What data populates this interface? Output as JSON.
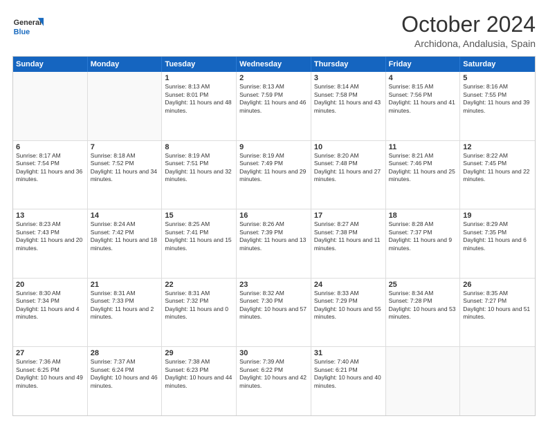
{
  "header": {
    "logo_general": "General",
    "logo_blue": "Blue",
    "month": "October 2024",
    "location": "Archidona, Andalusia, Spain"
  },
  "weekdays": [
    "Sunday",
    "Monday",
    "Tuesday",
    "Wednesday",
    "Thursday",
    "Friday",
    "Saturday"
  ],
  "rows": [
    [
      {
        "day": "",
        "text": ""
      },
      {
        "day": "",
        "text": ""
      },
      {
        "day": "1",
        "text": "Sunrise: 8:13 AM\nSunset: 8:01 PM\nDaylight: 11 hours and 48 minutes."
      },
      {
        "day": "2",
        "text": "Sunrise: 8:13 AM\nSunset: 7:59 PM\nDaylight: 11 hours and 46 minutes."
      },
      {
        "day": "3",
        "text": "Sunrise: 8:14 AM\nSunset: 7:58 PM\nDaylight: 11 hours and 43 minutes."
      },
      {
        "day": "4",
        "text": "Sunrise: 8:15 AM\nSunset: 7:56 PM\nDaylight: 11 hours and 41 minutes."
      },
      {
        "day": "5",
        "text": "Sunrise: 8:16 AM\nSunset: 7:55 PM\nDaylight: 11 hours and 39 minutes."
      }
    ],
    [
      {
        "day": "6",
        "text": "Sunrise: 8:17 AM\nSunset: 7:54 PM\nDaylight: 11 hours and 36 minutes."
      },
      {
        "day": "7",
        "text": "Sunrise: 8:18 AM\nSunset: 7:52 PM\nDaylight: 11 hours and 34 minutes."
      },
      {
        "day": "8",
        "text": "Sunrise: 8:19 AM\nSunset: 7:51 PM\nDaylight: 11 hours and 32 minutes."
      },
      {
        "day": "9",
        "text": "Sunrise: 8:19 AM\nSunset: 7:49 PM\nDaylight: 11 hours and 29 minutes."
      },
      {
        "day": "10",
        "text": "Sunrise: 8:20 AM\nSunset: 7:48 PM\nDaylight: 11 hours and 27 minutes."
      },
      {
        "day": "11",
        "text": "Sunrise: 8:21 AM\nSunset: 7:46 PM\nDaylight: 11 hours and 25 minutes."
      },
      {
        "day": "12",
        "text": "Sunrise: 8:22 AM\nSunset: 7:45 PM\nDaylight: 11 hours and 22 minutes."
      }
    ],
    [
      {
        "day": "13",
        "text": "Sunrise: 8:23 AM\nSunset: 7:43 PM\nDaylight: 11 hours and 20 minutes."
      },
      {
        "day": "14",
        "text": "Sunrise: 8:24 AM\nSunset: 7:42 PM\nDaylight: 11 hours and 18 minutes."
      },
      {
        "day": "15",
        "text": "Sunrise: 8:25 AM\nSunset: 7:41 PM\nDaylight: 11 hours and 15 minutes."
      },
      {
        "day": "16",
        "text": "Sunrise: 8:26 AM\nSunset: 7:39 PM\nDaylight: 11 hours and 13 minutes."
      },
      {
        "day": "17",
        "text": "Sunrise: 8:27 AM\nSunset: 7:38 PM\nDaylight: 11 hours and 11 minutes."
      },
      {
        "day": "18",
        "text": "Sunrise: 8:28 AM\nSunset: 7:37 PM\nDaylight: 11 hours and 9 minutes."
      },
      {
        "day": "19",
        "text": "Sunrise: 8:29 AM\nSunset: 7:35 PM\nDaylight: 11 hours and 6 minutes."
      }
    ],
    [
      {
        "day": "20",
        "text": "Sunrise: 8:30 AM\nSunset: 7:34 PM\nDaylight: 11 hours and 4 minutes."
      },
      {
        "day": "21",
        "text": "Sunrise: 8:31 AM\nSunset: 7:33 PM\nDaylight: 11 hours and 2 minutes."
      },
      {
        "day": "22",
        "text": "Sunrise: 8:31 AM\nSunset: 7:32 PM\nDaylight: 11 hours and 0 minutes."
      },
      {
        "day": "23",
        "text": "Sunrise: 8:32 AM\nSunset: 7:30 PM\nDaylight: 10 hours and 57 minutes."
      },
      {
        "day": "24",
        "text": "Sunrise: 8:33 AM\nSunset: 7:29 PM\nDaylight: 10 hours and 55 minutes."
      },
      {
        "day": "25",
        "text": "Sunrise: 8:34 AM\nSunset: 7:28 PM\nDaylight: 10 hours and 53 minutes."
      },
      {
        "day": "26",
        "text": "Sunrise: 8:35 AM\nSunset: 7:27 PM\nDaylight: 10 hours and 51 minutes."
      }
    ],
    [
      {
        "day": "27",
        "text": "Sunrise: 7:36 AM\nSunset: 6:25 PM\nDaylight: 10 hours and 49 minutes."
      },
      {
        "day": "28",
        "text": "Sunrise: 7:37 AM\nSunset: 6:24 PM\nDaylight: 10 hours and 46 minutes."
      },
      {
        "day": "29",
        "text": "Sunrise: 7:38 AM\nSunset: 6:23 PM\nDaylight: 10 hours and 44 minutes."
      },
      {
        "day": "30",
        "text": "Sunrise: 7:39 AM\nSunset: 6:22 PM\nDaylight: 10 hours and 42 minutes."
      },
      {
        "day": "31",
        "text": "Sunrise: 7:40 AM\nSunset: 6:21 PM\nDaylight: 10 hours and 40 minutes."
      },
      {
        "day": "",
        "text": ""
      },
      {
        "day": "",
        "text": ""
      }
    ]
  ]
}
